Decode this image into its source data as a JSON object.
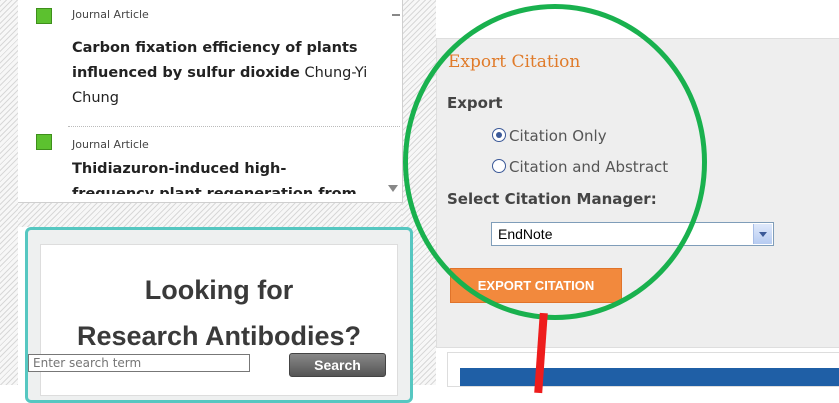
{
  "articles": [
    {
      "type": "Journal Article",
      "title": "Carbon fixation efficiency of plants influenced by sulfur dioxide",
      "author": "Chung-Yi Chung"
    },
    {
      "type": "Journal Article",
      "title_line1": "Thidiazuron-induced high-",
      "title_line2": "frequency plant regeneration from"
    }
  ],
  "ad": {
    "line1": "Looking for",
    "line2": "Research Antibodies?",
    "search_placeholder": "Enter search term",
    "search_button": "Search"
  },
  "export": {
    "title": "Export Citation",
    "export_label": "Export",
    "options": [
      "Citation Only",
      "Citation and Abstract"
    ],
    "selected_option": "Citation Only",
    "manager_label": "Select Citation Manager:",
    "manager_value": "EndNote",
    "button_label": "EXPORT CITATION"
  },
  "colors": {
    "accent_orange": "#f2893d",
    "highlight_green": "#19b14e",
    "arrow_red": "#ee1c1c",
    "ad_border": "#56c7c1"
  }
}
